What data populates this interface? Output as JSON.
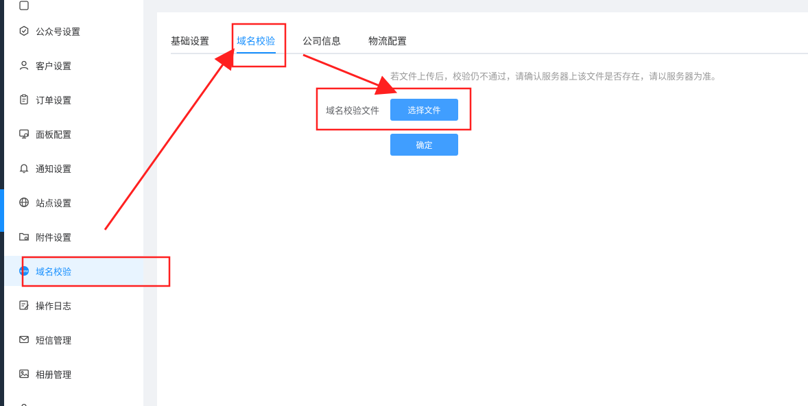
{
  "sidebar": {
    "items": [
      {
        "label": "公众号设置",
        "icon": "settings-check-icon"
      },
      {
        "label": "客户设置",
        "icon": "user-icon"
      },
      {
        "label": "订单设置",
        "icon": "clipboard-icon"
      },
      {
        "label": "面板配置",
        "icon": "monitor-icon"
      },
      {
        "label": "通知设置",
        "icon": "bell-icon"
      },
      {
        "label": "站点设置",
        "icon": "globe-icon"
      },
      {
        "label": "附件设置",
        "icon": "folder-icon"
      },
      {
        "label": "域名校验",
        "icon": "www-icon",
        "active": true
      },
      {
        "label": "操作日志",
        "icon": "edit-log-icon"
      },
      {
        "label": "短信管理",
        "icon": "mail-icon"
      },
      {
        "label": "相册管理",
        "icon": "image-icon"
      }
    ]
  },
  "tabs": [
    {
      "label": "基础设置"
    },
    {
      "label": "域名校验",
      "active": true
    },
    {
      "label": "公司信息"
    },
    {
      "label": "物流配置"
    }
  ],
  "form": {
    "hint": "若文件上传后，校验仍不通过，请确认服务器上该文件是否存在，请以服务器为准。",
    "label": "域名校验文件",
    "choose_button": "选择文件",
    "confirm_button": "确定"
  },
  "colors": {
    "accent": "#409eff",
    "active_bg": "#e8f4ff",
    "annotation": "#ff2020"
  }
}
